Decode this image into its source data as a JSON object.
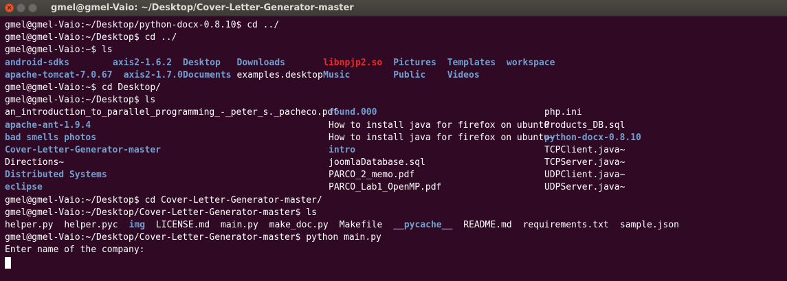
{
  "window": {
    "title": "gmel@gmel-Vaio: ~/Desktop/Cover-Letter-Generator-master",
    "close_glyph": "×"
  },
  "colors": {
    "background": "#300a24",
    "text": "#ffffff",
    "directory": "#729fcf",
    "archive": "#ef2929",
    "titlebar": "#3c3b37",
    "close_button": "#e8542a"
  },
  "terminal": {
    "lines": [
      [
        {
          "text": "gmel@gmel-Vaio:~/Desktop/python-docx-0.8.10$ cd ../",
          "kind": "text"
        }
      ],
      [
        {
          "text": "gmel@gmel-Vaio:~/Desktop$ cd ../",
          "kind": "text"
        }
      ],
      [
        {
          "text": "gmel@gmel-Vaio:~$ ls",
          "kind": "text"
        }
      ],
      [
        {
          "text": "android-sdks",
          "kind": "dir",
          "col": 0
        },
        {
          "text": "axis2-1.6.2",
          "kind": "dir",
          "col": 20
        },
        {
          "text": "Desktop",
          "kind": "dir",
          "col": 33
        },
        {
          "text": "Downloads",
          "kind": "dir",
          "col": 43
        },
        {
          "text": "libnpjp2.so",
          "kind": "archive",
          "col": 59
        },
        {
          "text": "Pictures",
          "kind": "dir",
          "col": 72
        },
        {
          "text": "Templates",
          "kind": "dir",
          "col": 82
        },
        {
          "text": "workspace",
          "kind": "dir",
          "col": 93
        }
      ],
      [
        {
          "text": "apache-tomcat-7.0.67",
          "kind": "dir",
          "col": 0
        },
        {
          "text": "axis2-1.7.0",
          "kind": "dir",
          "col": 22
        },
        {
          "text": "Documents",
          "kind": "dir",
          "col": 33
        },
        {
          "text": "examples.desktop",
          "kind": "text",
          "col": 43
        },
        {
          "text": "Music",
          "kind": "dir",
          "col": 59
        },
        {
          "text": "Public",
          "kind": "dir",
          "col": 72
        },
        {
          "text": "Videos",
          "kind": "dir",
          "col": 82
        }
      ],
      [
        {
          "text": "gmel@gmel-Vaio:~$ cd Desktop/",
          "kind": "text"
        }
      ],
      [
        {
          "text": "gmel@gmel-Vaio:~/Desktop$ ls",
          "kind": "text"
        }
      ],
      [
        {
          "text": "an_introduction_to_parallel_programming_-_peter_s._pacheco.pdf",
          "kind": "text",
          "col": 0
        },
        {
          "text": "found.000",
          "kind": "dir",
          "col": 60
        },
        {
          "text": "php.ini",
          "kind": "text",
          "col": 100
        }
      ],
      [
        {
          "text": "apache-ant-1.9.4",
          "kind": "dir",
          "col": 0
        },
        {
          "text": "How to install java for firefox on ubuntu",
          "kind": "text",
          "col": 60
        },
        {
          "text": "Products_DB.sql",
          "kind": "text",
          "col": 100
        }
      ],
      [
        {
          "text": "bad smells photos",
          "kind": "dir",
          "col": 0
        },
        {
          "text": "How to install java for firefox on ubuntu~",
          "kind": "text",
          "col": 60
        },
        {
          "text": "python-docx-0.8.10",
          "kind": "dir",
          "col": 100
        }
      ],
      [
        {
          "text": "Cover-Letter-Generator-master",
          "kind": "dir",
          "col": 0
        },
        {
          "text": "intro",
          "kind": "dir",
          "col": 60
        },
        {
          "text": "TCPClient.java~",
          "kind": "text",
          "col": 100
        }
      ],
      [
        {
          "text": "Directions~",
          "kind": "text",
          "col": 0
        },
        {
          "text": "joomlaDatabase.sql",
          "kind": "text",
          "col": 60
        },
        {
          "text": "TCPServer.java~",
          "kind": "text",
          "col": 100
        }
      ],
      [
        {
          "text": "Distributed Systems",
          "kind": "dir",
          "col": 0
        },
        {
          "text": "PARCO_2_memo.pdf",
          "kind": "text",
          "col": 60
        },
        {
          "text": "UDPClient.java~",
          "kind": "text",
          "col": 100
        }
      ],
      [
        {
          "text": "eclipse",
          "kind": "dir",
          "col": 0
        },
        {
          "text": "PARCO_Lab1_OpenMP.pdf",
          "kind": "text",
          "col": 60
        },
        {
          "text": "UDPServer.java~",
          "kind": "text",
          "col": 100
        }
      ],
      [
        {
          "text": "gmel@gmel-Vaio:~/Desktop$ cd Cover-Letter-Generator-master/",
          "kind": "text"
        }
      ],
      [
        {
          "text": "gmel@gmel-Vaio:~/Desktop/Cover-Letter-Generator-master$ ls",
          "kind": "text"
        }
      ],
      [
        {
          "text": "helper.py",
          "kind": "text",
          "col": 0
        },
        {
          "text": "helper.pyc",
          "kind": "text",
          "col": 11
        },
        {
          "text": "img",
          "kind": "dir",
          "col": 23
        },
        {
          "text": "LICENSE.md",
          "kind": "text",
          "col": 28
        },
        {
          "text": "main.py",
          "kind": "text",
          "col": 40
        },
        {
          "text": "make_doc.py",
          "kind": "text",
          "col": 49
        },
        {
          "text": "Makefile",
          "kind": "text",
          "col": 62
        },
        {
          "text": "__pycache__",
          "kind": "dir",
          "col": 72
        },
        {
          "text": "README.md",
          "kind": "text",
          "col": 85
        },
        {
          "text": "requirements.txt",
          "kind": "text",
          "col": 96
        },
        {
          "text": "sample.json",
          "kind": "text",
          "col": 114
        }
      ],
      [
        {
          "text": "gmel@gmel-Vaio:~/Desktop/Cover-Letter-Generator-master$ python main.py",
          "kind": "text"
        }
      ],
      [
        {
          "text": "Enter name of the company:",
          "kind": "text"
        }
      ]
    ]
  }
}
